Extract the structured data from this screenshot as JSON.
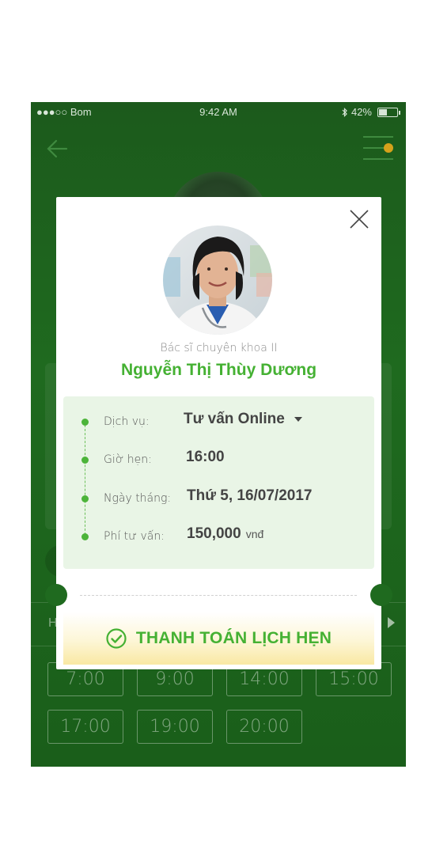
{
  "status_bar": {
    "carrier": "●●●○○ Bom",
    "time": "9:42 AM",
    "battery": "42%",
    "battery_level": 0.42
  },
  "header": {
    "back_icon": "back-arrow-icon",
    "menu_icon": "filter-menu-icon"
  },
  "background_tab_letter": "H",
  "time_slots": [
    "7:00",
    "9:00",
    "14:00",
    "15:00",
    "17:00",
    "19:00",
    "20:00"
  ],
  "modal": {
    "doctor_title": "Bác sĩ chuyên khoa II",
    "doctor_name": "Nguyễn Thị Thùy Dương",
    "details": {
      "service_label": "Dịch vụ:",
      "service_value": "Tư vấn Online",
      "time_label": "Giờ hẹn:",
      "time_value": "16:00",
      "date_label": "Ngày tháng:",
      "date_value": "Thứ 5, 16/07/2017",
      "fee_label": "Phí tư vấn:",
      "fee_value": "150,000",
      "fee_unit": "vnđ"
    },
    "pay_button": "THANH TOÁN LỊCH HẸN"
  },
  "colors": {
    "brand_green": "#45b133",
    "background_green": "#1f6a1f",
    "info_box": "#e9f5e6",
    "accent_dot": "#d6a21b"
  }
}
